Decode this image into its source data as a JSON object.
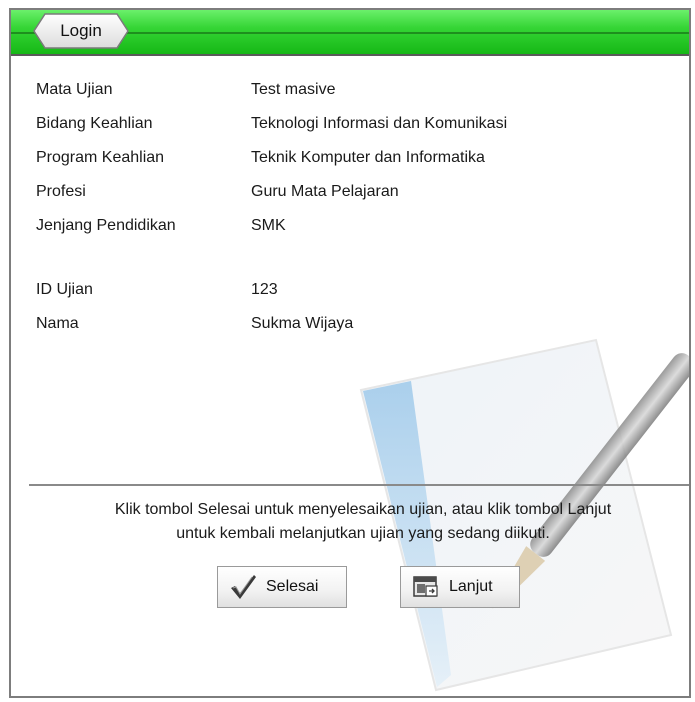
{
  "header": {
    "tab_label": "Login",
    "bar_color": "#2dc92d"
  },
  "info": {
    "rows": [
      {
        "label": "Mata Ujian",
        "value": "Test masive"
      },
      {
        "label": "Bidang Keahlian",
        "value": "Teknologi Informasi dan Komunikasi"
      },
      {
        "label": "Program Keahlian",
        "value": "Teknik Komputer dan Informatika"
      },
      {
        "label": "Profesi",
        "value": "Guru Mata Pelajaran"
      },
      {
        "label": "Jenjang Pendidikan",
        "value": "SMK"
      }
    ],
    "participant": [
      {
        "label": "ID Ujian",
        "value": "123"
      },
      {
        "label": "Nama",
        "value": "Sukma Wijaya"
      }
    ]
  },
  "message": {
    "line1": "Klik tombol Selesai untuk menyelesaikan ujian, atau klik tombol Lanjut",
    "line2": "untuk kembali melanjutkan ujian yang sedang diikuti."
  },
  "buttons": {
    "finish": {
      "label": "Selesai",
      "icon": "checkmark-icon"
    },
    "continue": {
      "label": "Lanjut",
      "icon": "window-return-icon"
    }
  }
}
